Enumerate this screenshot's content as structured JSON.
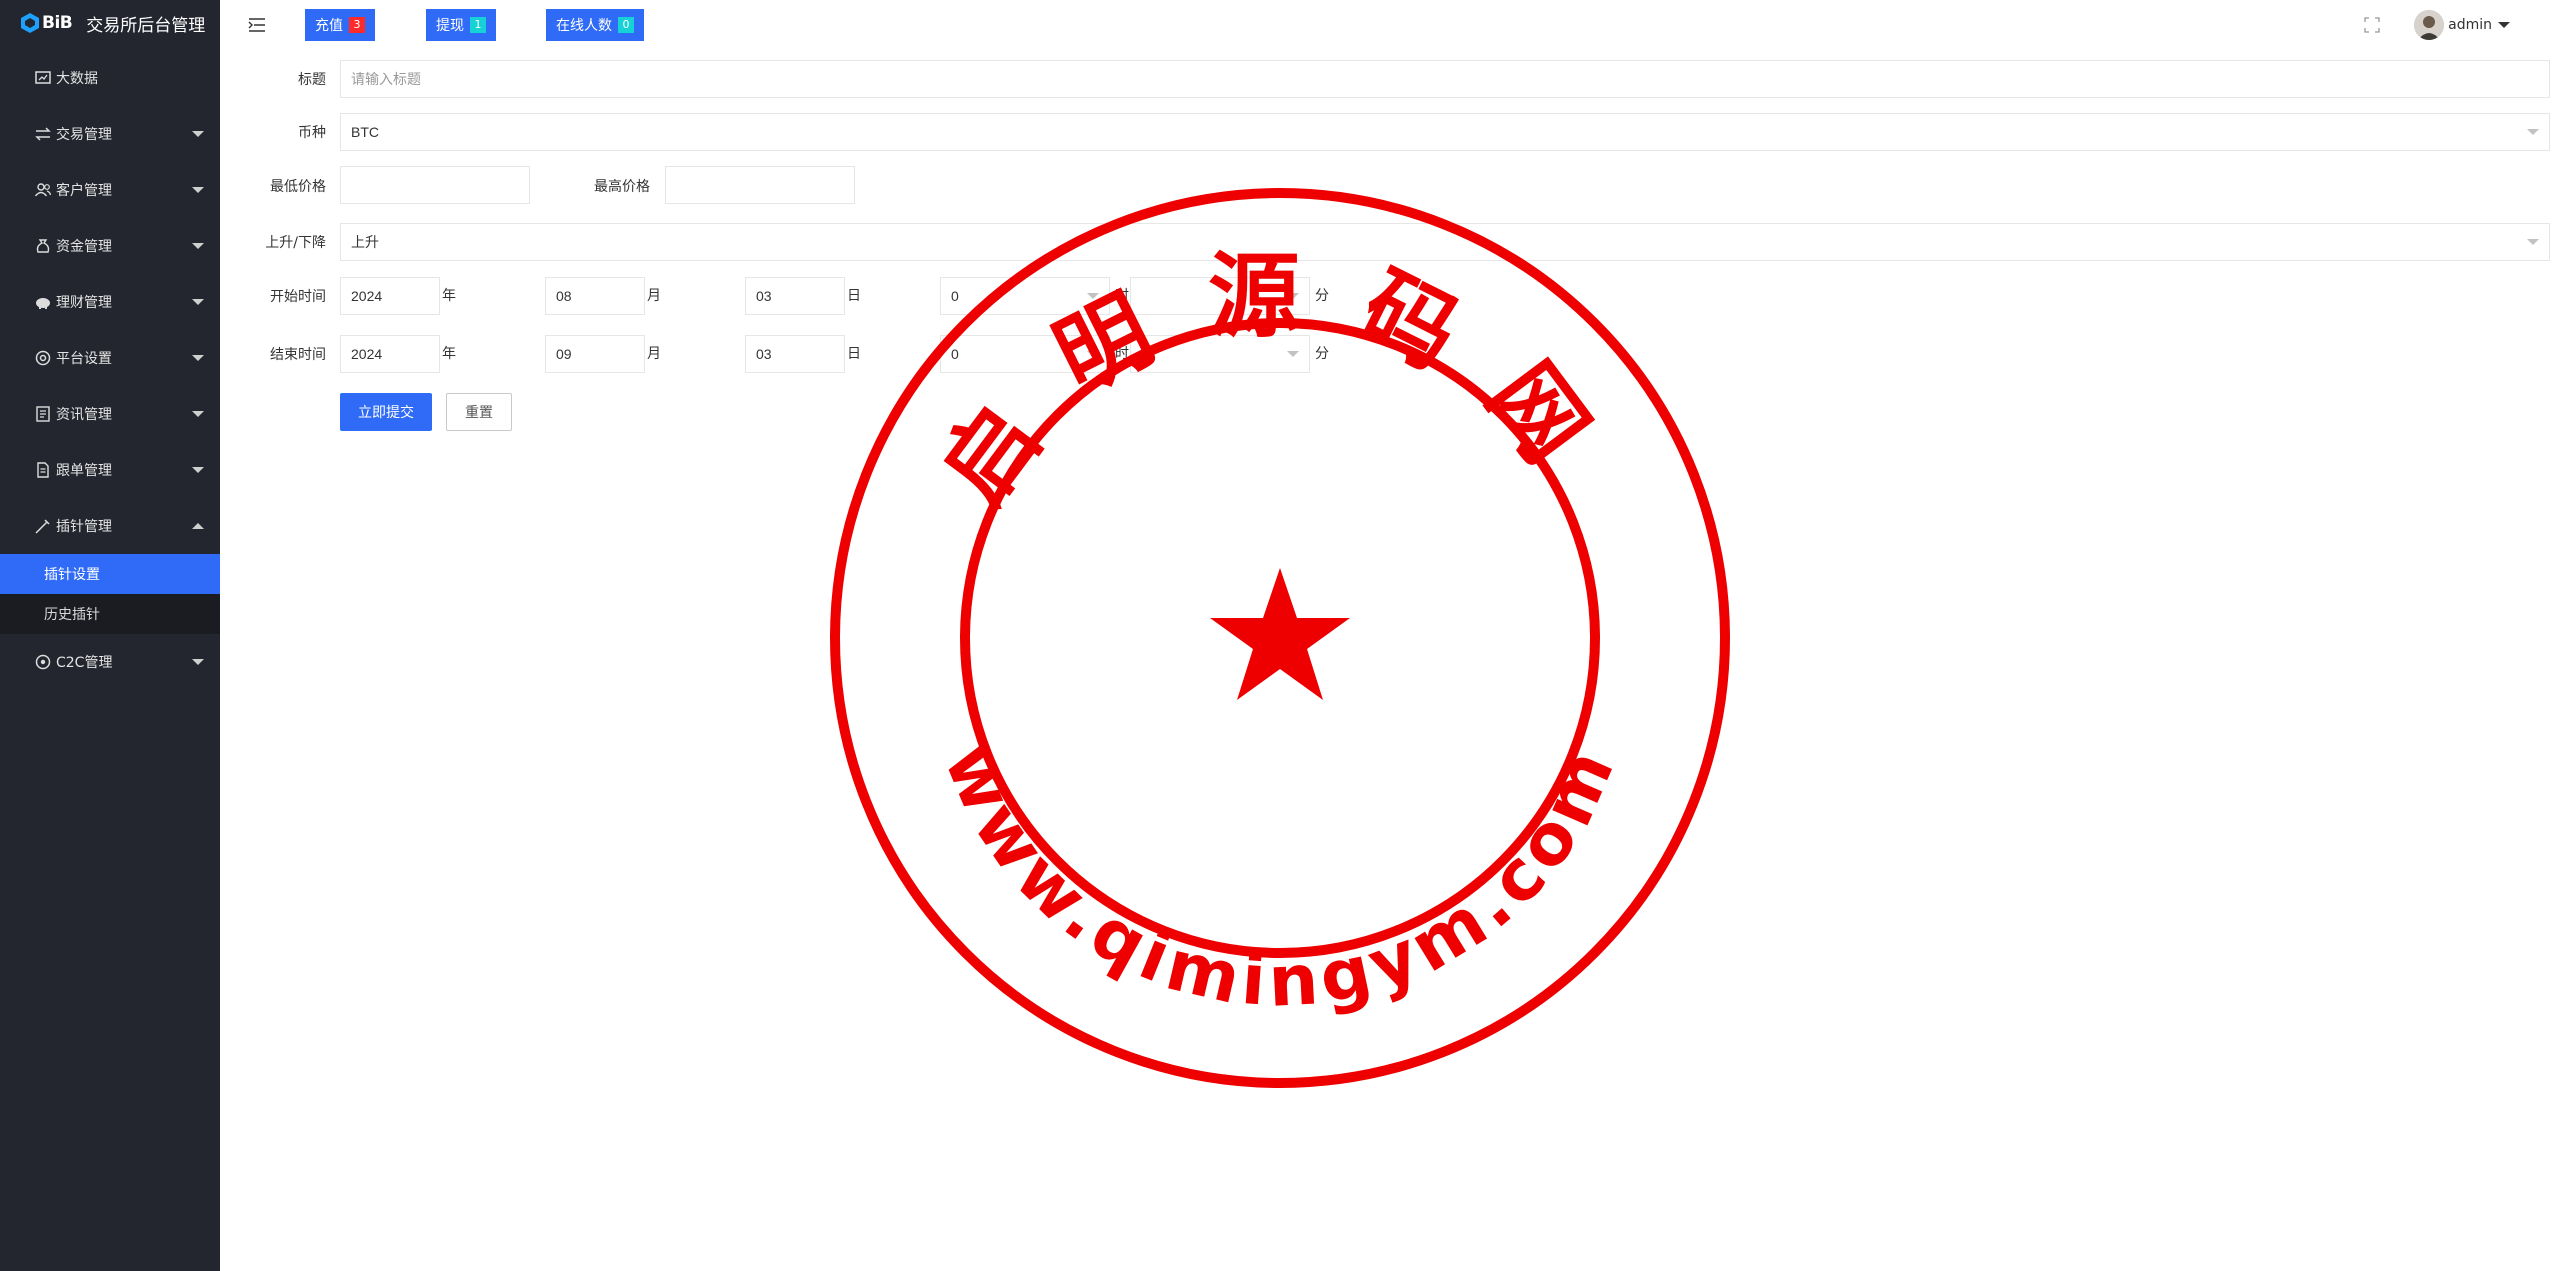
{
  "brand": {
    "logo_text": "BiB",
    "title": "交易所后台管理"
  },
  "sidebar": {
    "items": [
      {
        "label": "大数据",
        "icon": "dashboard-icon"
      },
      {
        "label": "交易管理",
        "icon": "exchange-icon"
      },
      {
        "label": "客户管理",
        "icon": "users-icon"
      },
      {
        "label": "资金管理",
        "icon": "money-bag-icon"
      },
      {
        "label": "理财管理",
        "icon": "piggy-bank-icon"
      },
      {
        "label": "平台设置",
        "icon": "settings-icon"
      },
      {
        "label": "资讯管理",
        "icon": "news-icon"
      },
      {
        "label": "跟单管理",
        "icon": "document-icon"
      },
      {
        "label": "插针管理",
        "icon": "needle-icon"
      },
      {
        "label": "C2C管理",
        "icon": "c2c-icon"
      }
    ],
    "submenu": [
      {
        "label": "插针设置",
        "active": true
      },
      {
        "label": "历史插针",
        "active": false
      }
    ]
  },
  "header": {
    "recharge": {
      "label": "充值",
      "count": "3"
    },
    "withdraw": {
      "label": "提现",
      "count": "1"
    },
    "online": {
      "label": "在线人数",
      "count": "0"
    },
    "user": "admin"
  },
  "form": {
    "title_label": "标题",
    "title_placeholder": "请输入标题",
    "coin_label": "币种",
    "coin_value": "BTC",
    "min_price_label": "最低价格",
    "max_price_label": "最高价格",
    "direction_label": "上升/下降",
    "direction_value": "上升",
    "start_label": "开始时间",
    "start": {
      "year": "2024",
      "month": "08",
      "day": "03",
      "hour": "0"
    },
    "end_label": "结束时间",
    "end": {
      "year": "2024",
      "month": "09",
      "day": "03",
      "hour": "0"
    },
    "unit_year": "年",
    "unit_month": "月",
    "unit_day": "日",
    "unit_hour": "时",
    "unit_minute": "分",
    "submit": "立即提交",
    "reset": "重置"
  },
  "watermark": {
    "top_text": "启明源码网",
    "bottom_text": "www.qimingym.com",
    "color": "#ee0000"
  }
}
